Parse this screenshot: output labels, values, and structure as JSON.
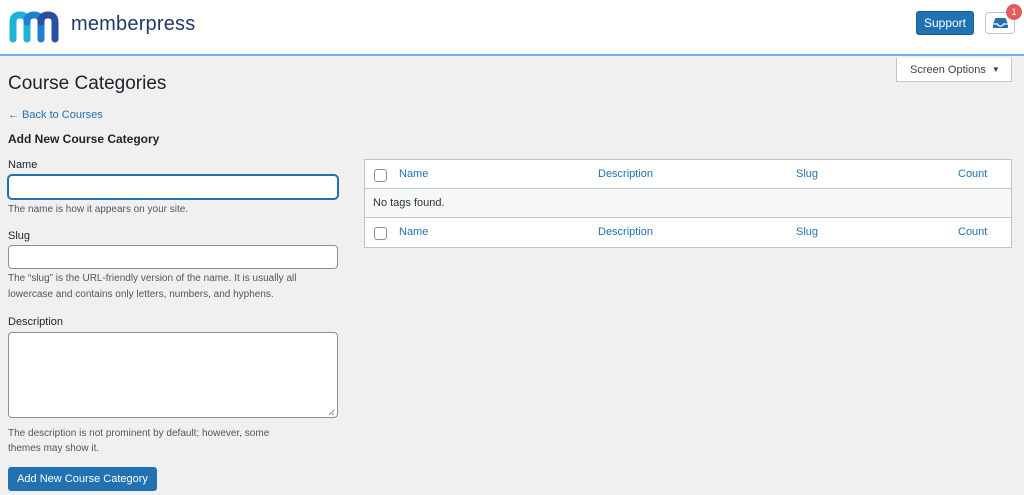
{
  "header": {
    "brand": "memberpress",
    "support_label": "Support",
    "notification_count": "1"
  },
  "screen_options": {
    "label": "Screen Options"
  },
  "page": {
    "title": "Course Categories",
    "back_link": "← Back to Courses",
    "section_title": "Add New Course Category"
  },
  "form": {
    "name_label": "Name",
    "name_value": "",
    "name_help": "The name is how it appears on your site.",
    "slug_label": "Slug",
    "slug_value": "",
    "slug_help_1": "The “slug” is the URL-friendly version of the name. It is usually all",
    "slug_help_2": "lowercase and contains only letters, numbers, and hyphens.",
    "description_label": "Description",
    "description_value": "",
    "description_help_1": "The description is not prominent by default; however, some",
    "description_help_2": "themes may show it.",
    "submit_label": "Add New Course Category"
  },
  "table": {
    "columns": [
      "Name",
      "Description",
      "Slug",
      "Count"
    ],
    "empty_message": "No tags found."
  },
  "colors": {
    "accent": "#2271b1",
    "brand_navy": "#1f3a68",
    "badge": "#e05d5d"
  },
  "icons": [
    "memberpress-logo-icon",
    "inbox-icon",
    "caret-down-icon",
    "resize-handle-icon"
  ]
}
